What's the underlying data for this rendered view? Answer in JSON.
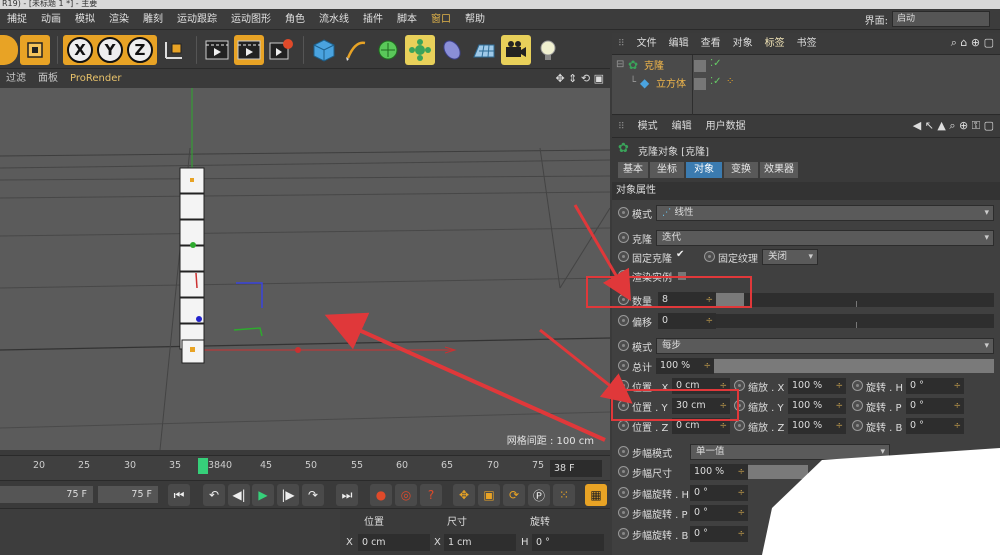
{
  "window": {
    "title": "R19) - [未标题 1 *] - 主要"
  },
  "menu": {
    "items": [
      "捕捉",
      "动画",
      "模拟",
      "渲染",
      "雕刻",
      "运动跟踪",
      "运动图形",
      "角色",
      "流水线",
      "插件",
      "脚本",
      "窗口",
      "帮助"
    ],
    "interface_label": "界面:",
    "interface_value": "启动"
  },
  "toolbar": {
    "axis_x": "X",
    "axis_y": "Y",
    "axis_z": "Z"
  },
  "viewport": {
    "menu": [
      "过滤",
      "面板",
      "ProRender"
    ],
    "grid_distance": "网格间距 : 100 cm"
  },
  "timeline": {
    "ticks": [
      "20",
      "25",
      "30",
      "35",
      "38",
      "40",
      "45",
      "50",
      "55",
      "60",
      "65",
      "70",
      "75"
    ],
    "current_frame_label": "38",
    "current_frame_field": "38 F",
    "start_field": "75 F",
    "end_field": "75 F"
  },
  "coord_panel": {
    "headers": [
      "位置",
      "尺寸",
      "旋转"
    ],
    "x_label": "X",
    "x_pos": "0 cm",
    "x_size_label": "X",
    "x_size": "1 cm",
    "h_label": "H",
    "h_rot": "0 °"
  },
  "object_manager": {
    "menu": [
      "文件",
      "编辑",
      "查看",
      "对象",
      "标签",
      "书签"
    ],
    "objects": [
      {
        "name": "克隆",
        "selected": false
      },
      {
        "name": "立方体",
        "selected": true
      }
    ]
  },
  "attribute_manager": {
    "menu": [
      "模式",
      "编辑",
      "用户数据"
    ],
    "title": "克隆对象 [克隆]",
    "tabs": [
      "基本",
      "坐标",
      "对象",
      "变换",
      "效果器"
    ],
    "active_tab": "对象",
    "section": "对象属性",
    "mode_label": "模式",
    "mode_value": "线性",
    "clone_label": "克隆",
    "clone_value": "迭代",
    "fix_clone_label": "固定克隆",
    "fix_clone_check": "✔",
    "fix_texture_label": "固定纹理",
    "fix_texture_value": "关闭",
    "render_instance_label": "渲染实例",
    "count_label": "数量",
    "count_value": "8",
    "count_fraction": 0.1,
    "offset_label": "偏移",
    "offset_value": "0",
    "mode2_label": "模式",
    "mode2_value": "每步",
    "total_label": "总计",
    "total_value": "100 %",
    "pos_x_label": "位置 . X",
    "pos_x_value": "0 cm",
    "pos_y_label": "位置 . Y",
    "pos_y_value": "30 cm",
    "pos_z_label": "位置 . Z",
    "pos_z_value": "0 cm",
    "scale_x_label": "缩放 . X",
    "scale_x_value": "100 %",
    "scale_y_label": "缩放 . Y",
    "scale_y_value": "100 %",
    "scale_z_label": "缩放 . Z",
    "scale_z_value": "100 %",
    "rot_h_label": "旋转 . H",
    "rot_h_value": "0 °",
    "rot_p_label": "旋转 . P",
    "rot_p_value": "0 °",
    "rot_b_label": "旋转 . B",
    "rot_b_value": "0 °",
    "step_mode_label": "步幅模式",
    "step_mode_value": "单一值",
    "step_size_label": "步幅尺寸",
    "step_size_value": "100 %",
    "step_rot_h_label": "步幅旋转 . H",
    "step_rot_h_value": "0 °",
    "step_rot_p_label": "步幅旋转 . P",
    "step_rot_p_value": "0 °",
    "step_rot_b_label": "步幅旋转 . B",
    "step_rot_b_value": "0 °"
  },
  "colors": {
    "accent": "#e0b34a",
    "active_tab": "#3b7bb0",
    "annotation_red": "#e0383a",
    "selected_object": "#f0b64b"
  }
}
